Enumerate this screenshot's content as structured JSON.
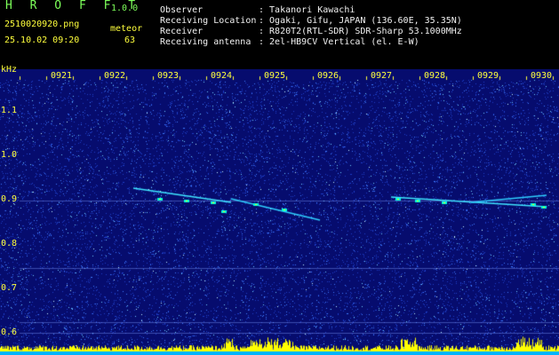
{
  "header": {
    "app_name": "H R O F F T",
    "version": "1.0.0",
    "file_name": "2510020920.png",
    "datetime": "25.10.02 09:20",
    "mode_label": "meteor",
    "count": "63",
    "info": [
      {
        "label": "Observer",
        "value": ": Takanori Kawachi"
      },
      {
        "label": "Receiving Location",
        "value": ": Ogaki, Gifu, JAPAN (136.60E, 35.35N)"
      },
      {
        "label": "Receiver",
        "value": ": R820T2(RTL-SDR) SDR-Sharp 53.1000MHz"
      },
      {
        "label": "Receiving antenna",
        "value": ": 2el-HB9CV Vertical (el. E-W)"
      }
    ]
  },
  "plot": {
    "unit_label": "kHz",
    "time_ticks": [
      "0921",
      "0922",
      "0923",
      "0924",
      "0925",
      "0926",
      "0927",
      "0928",
      "0929",
      "0930"
    ],
    "freq_ticks": [
      "1.1",
      "1.0",
      "0.9",
      "0.8",
      "0.7",
      "0.6"
    ],
    "colors": {
      "background": "#060c6e",
      "noise": "#2a5cff",
      "trace": "#00ffe0",
      "baseline": "#ffff00",
      "grid": "#5566ff"
    }
  }
}
